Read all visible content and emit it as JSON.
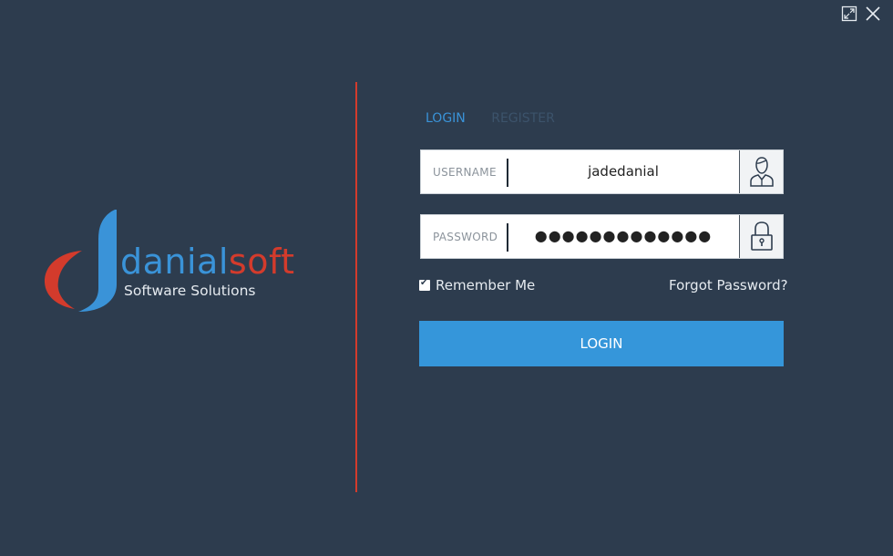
{
  "window": {
    "restore_icon": "restore-down-icon",
    "close_icon": "close-icon"
  },
  "logo": {
    "brand_part1": "danial",
    "brand_part2": "soft",
    "tagline": "Software Solutions",
    "colors": {
      "blue": "#3a93d8",
      "red": "#d33b2c"
    }
  },
  "tabs": {
    "login": "LOGIN",
    "register": "REGISTER",
    "active": "LOGIN"
  },
  "form": {
    "username_label": "USERNAME",
    "username_value": "jadedanial",
    "username_icon": "user-icon",
    "password_label": "PASSWORD",
    "password_value": "●●●●●●●●●●●●●",
    "password_icon": "padlock-icon",
    "remember_label": "Remember Me",
    "remember_checked": true,
    "forgot_label": "Forgot Password?",
    "submit_label": "LOGIN"
  },
  "colors": {
    "background": "#2d3c4e",
    "accent": "#3596da",
    "divider": "#d33b2c"
  }
}
